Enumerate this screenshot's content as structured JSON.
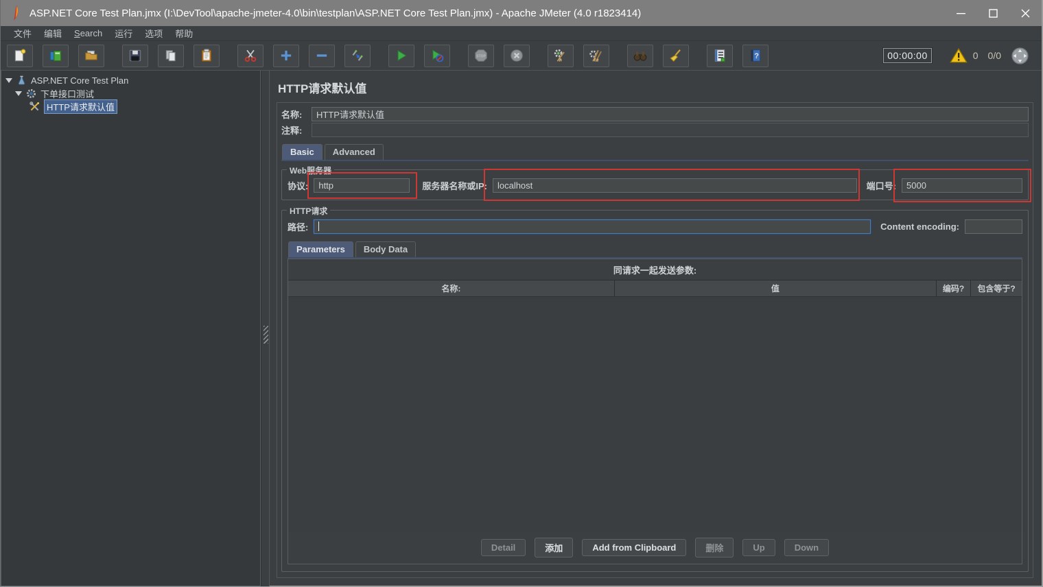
{
  "window": {
    "title": "ASP.NET Core Test Plan.jmx (I:\\DevTool\\apache-jmeter-4.0\\bin\\testplan\\ASP.NET Core Test Plan.jmx) - Apache JMeter (4.0 r1823414)",
    "app_icon": "jmeter-feather-icon"
  },
  "menu": {
    "items": [
      "文件",
      "编辑",
      "Search",
      "运行",
      "选项",
      "帮助"
    ]
  },
  "toolbar": {
    "icons": [
      "new-file",
      "templates",
      "open-file",
      "save",
      "cut",
      "copy",
      "paste",
      "add",
      "remove",
      "toggle",
      "start",
      "start-no-timers",
      "stop",
      "shutdown",
      "clear",
      "clear-all",
      "search",
      "clear-search",
      "function-helper",
      "help"
    ],
    "timer": "00:00:00",
    "warning_count": "0",
    "threads": "0/0"
  },
  "tree": {
    "items": [
      {
        "label": "ASP.NET Core Test Plan",
        "icon": "test-plan-icon",
        "selected": false
      },
      {
        "label": "下单接口测试",
        "icon": "thread-group-icon",
        "selected": false
      },
      {
        "label": "HTTP请求默认值",
        "icon": "http-defaults-icon",
        "selected": true
      }
    ]
  },
  "main": {
    "title": "HTTP请求默认值",
    "name_label": "名称:",
    "name_value": "HTTP请求默认值",
    "comment_label": "注释:",
    "comment_value": "",
    "tabs": {
      "basic": "Basic",
      "advanced": "Advanced"
    },
    "web_server": {
      "legend": "Web服务器",
      "protocol_label": "协议:",
      "protocol_value": "http",
      "server_label": "服务器名称或IP:",
      "server_value": "localhost",
      "port_label": "端口号:",
      "port_value": "5000"
    },
    "http_request": {
      "legend": "HTTP请求",
      "path_label": "路径:",
      "path_value": "",
      "content_encoding_label": "Content encoding:",
      "content_encoding_value": "",
      "tabs": {
        "parameters": "Parameters",
        "body_data": "Body Data"
      },
      "params_caption": "同请求一起发送参数:",
      "columns": [
        "名称:",
        "值",
        "编码?",
        "包含等于?"
      ],
      "buttons": [
        {
          "label": "Detail",
          "enabled": false
        },
        {
          "label": "添加",
          "enabled": true
        },
        {
          "label": "Add from Clipboard",
          "enabled": true
        },
        {
          "label": "删除",
          "enabled": false
        },
        {
          "label": "Up",
          "enabled": false
        },
        {
          "label": "Down",
          "enabled": false
        }
      ]
    }
  },
  "colors": {
    "annotation": "#cf3732",
    "selection": "#44608c",
    "accent_blue": "#4a7bbd"
  }
}
